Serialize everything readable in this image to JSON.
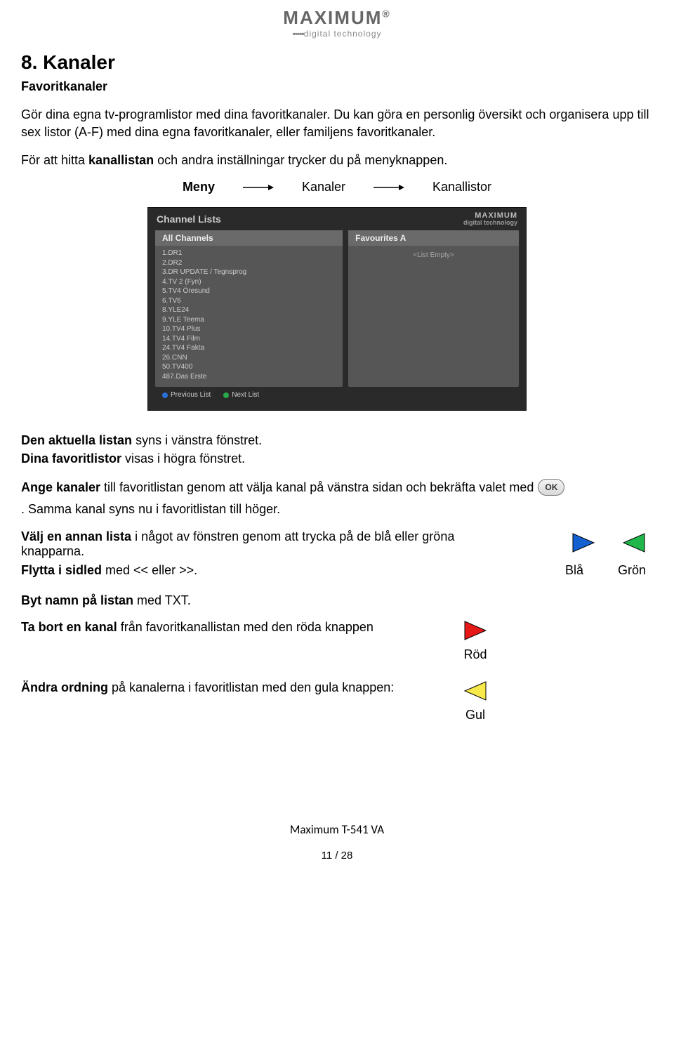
{
  "logo": {
    "main": "MAXIMUM",
    "sub": "digital technology"
  },
  "h1": "8. Kanaler",
  "subheading": "Favoritkanaler",
  "p1": "Gör dina egna tv-programlistor med dina favoritkanaler. Du kan göra en personlig översikt och organisera upp till sex listor (A-F) med dina egna favoritkanaler, eller familjens favoritkanaler.",
  "p2_pre": "För att hitta ",
  "p2_bold": "kanallistan",
  "p2_post": " och andra inställningar trycker du på menyknappen.",
  "breadcrumb": {
    "a": "Meny",
    "b": "Kanaler",
    "c": "Kanallistor"
  },
  "screenshot": {
    "title": "Channel Lists",
    "brand_top": "MAXIMUM",
    "brand_sub": "digital technology",
    "left_header": "All Channels",
    "right_header": "Favourites A",
    "empty": "<List Empty>",
    "channels": [
      "1.DR1",
      "2.DR2",
      "3.DR UPDATE / Tegnsprog",
      "4.TV 2 (Fyn)",
      "5.TV4 Öresund",
      "6.TV6",
      "8.YLE24",
      "9.YLE Teema",
      "10.TV4 Plus",
      "14.TV4 Film",
      "24.TV4 Fakta",
      "26.CNN",
      "50.TV400",
      "487.Das Erste"
    ],
    "prev": "Previous List",
    "next": "Next List"
  },
  "p3_b": "Den aktuella listan",
  "p3_rest": " syns i vänstra fönstret.",
  "p4_b": "Dina favoritlistor",
  "p4_rest": " visas i högra fönstret.",
  "p5_b": "Ange kanaler",
  "p5_mid": " till favoritlistan genom att välja kanal på vänstra sidan och bekräfta valet med ",
  "ok_label": "OK",
  "p5_end": ". Samma kanal syns nu i favoritlistan till höger.",
  "p6_b": "Välj en annan lista",
  "p6_rest": " i något av fönstren genom att trycka på de blå eller gröna knapparna.",
  "p7_b": "Flytta i sidled",
  "p7_rest": " med  <<  eller >>.",
  "label_blue": "Blå",
  "label_green": "Grön",
  "p8_b": "Byt namn på listan",
  "p8_rest": " med TXT.",
  "p9_b": "Ta bort en kanal",
  "p9_rest": " från favoritkanallistan med den röda knappen",
  "label_red": "Röd",
  "p10_b": "Ändra ordning",
  "p10_rest": " på kanalerna i favoritlistan med den gula knappen:",
  "label_yellow": "Gul",
  "footer_model": "Maximum  T-541 VA",
  "footer_page": "11 / 28"
}
